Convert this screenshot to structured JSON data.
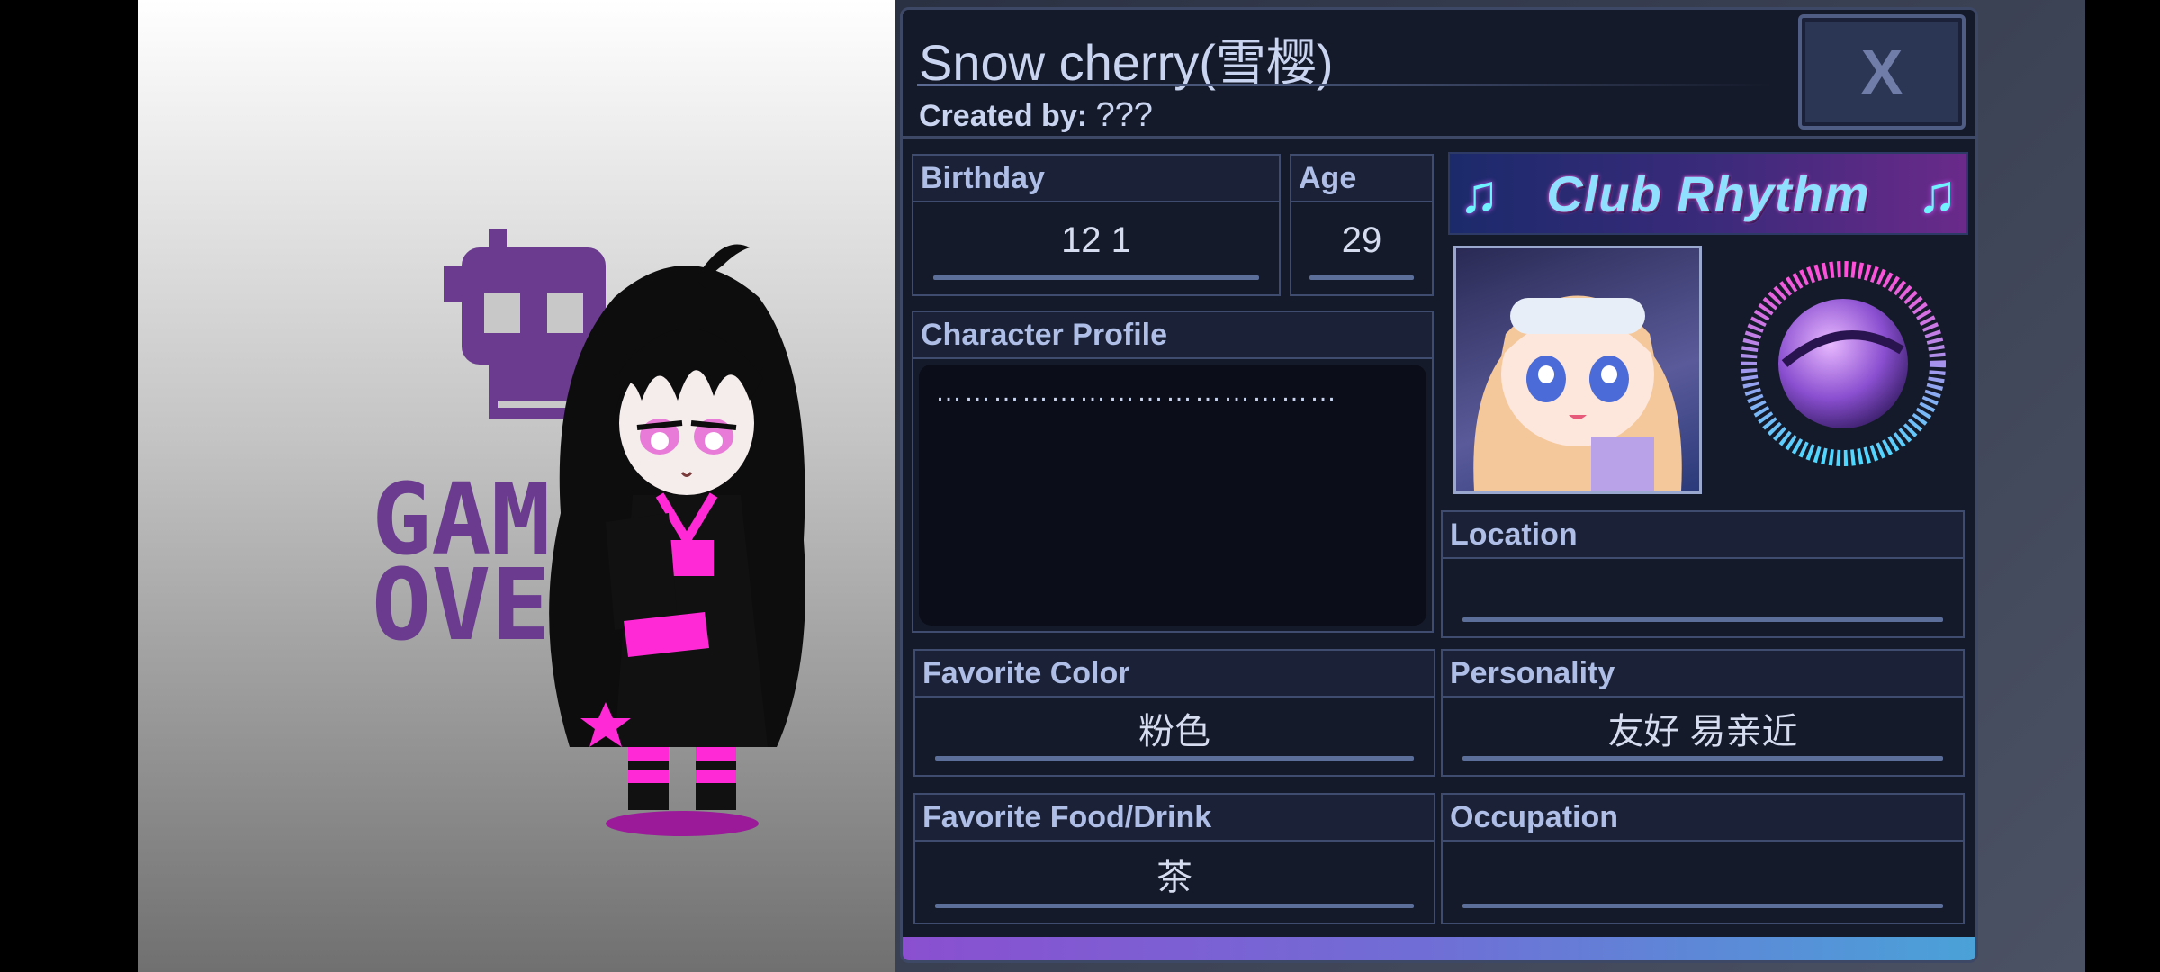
{
  "profile": {
    "name": "Snow cherry(雪樱)",
    "created_by_label": "Created by:",
    "created_by_value": "???",
    "close_label": "X"
  },
  "fields": {
    "birthday": {
      "label": "Birthday",
      "value": "12 1"
    },
    "age": {
      "label": "Age",
      "value": "29"
    },
    "character_profile": {
      "label": "Character Profile",
      "value": "……………………………………"
    },
    "location": {
      "label": "Location",
      "value": ""
    },
    "favorite_color": {
      "label": "Favorite Color",
      "value": "粉色"
    },
    "personality": {
      "label": "Personality",
      "value": "友好 易亲近"
    },
    "favorite_food": {
      "label": "Favorite Food/Drink",
      "value": "茶"
    },
    "occupation": {
      "label": "Occupation",
      "value": ""
    }
  },
  "banner": {
    "title": "Club Rhythm"
  },
  "background_art": {
    "text_line1": "GAM",
    "text_line2": "OVE"
  },
  "colors": {
    "panel_bg": "#151a2a",
    "panel_border": "#3d4867",
    "label_text": "#aebee6",
    "accent_pink": "#ff2ad6",
    "accent_purple": "#7b3fa3"
  }
}
